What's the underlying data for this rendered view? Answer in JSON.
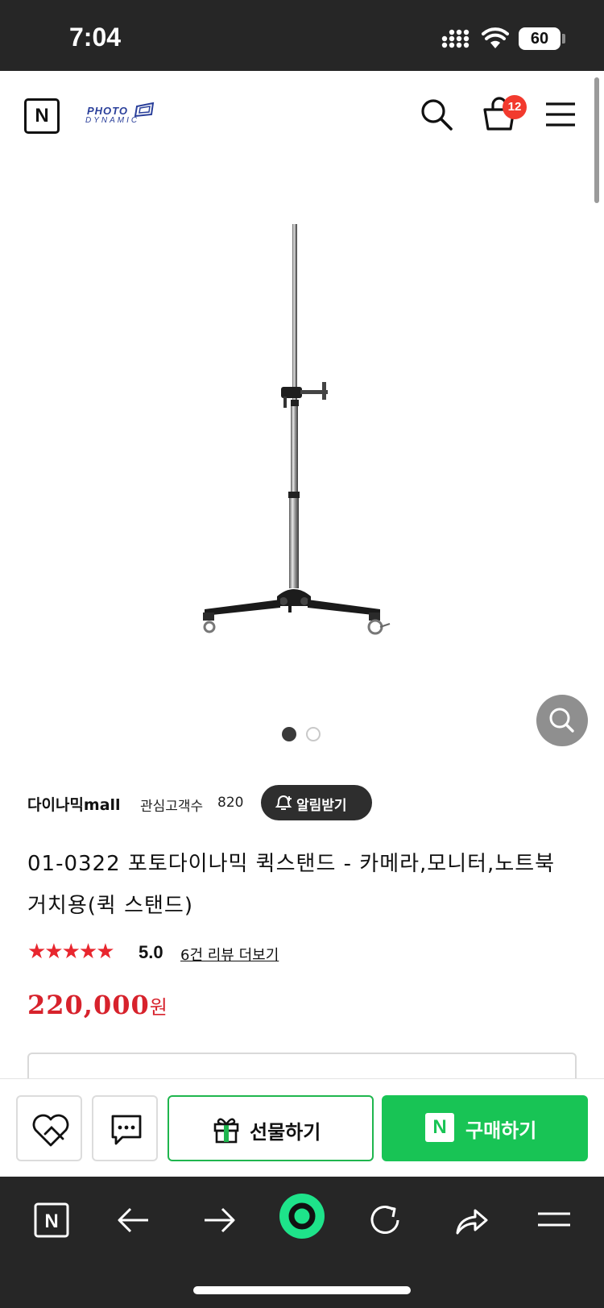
{
  "status_bar": {
    "time": "7:04",
    "battery": "60"
  },
  "header": {
    "brand_logo_line1": "PHOTO",
    "brand_logo_line2": "DYNAMIC",
    "cart_count": "12"
  },
  "gallery": {
    "image_count": 2,
    "active_index": 1
  },
  "store": {
    "name": "다이나믹mall",
    "follower_label": "관심고객수",
    "follower_count": "820",
    "alarm_button": "알림받기"
  },
  "product": {
    "title": "01-0322 포토다이나믹 퀵스탠드 - 카메라,모니터,노트북 거치용(퀵 스탠드)",
    "stars": "★★★★★",
    "rating": "5.0",
    "reviews_link": "6건 리뷰 더보기",
    "price": "220,000",
    "currency": "원"
  },
  "buy_bar": {
    "gift_label": "선물하기",
    "buy_logo": "N",
    "buy_label": "구매하기"
  },
  "browser_bar": {
    "home_logo": "N",
    "accent_color": "#1ee38a"
  }
}
